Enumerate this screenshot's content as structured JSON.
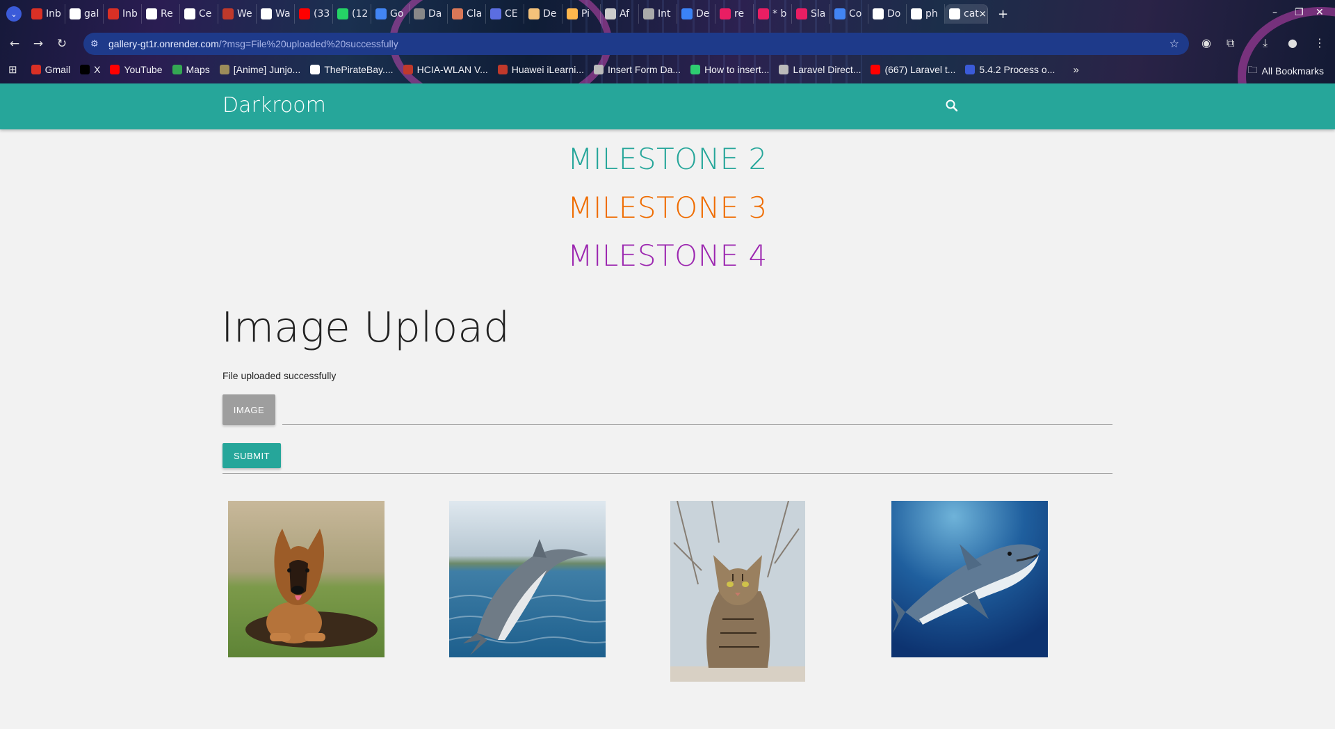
{
  "browser": {
    "tabs": [
      {
        "title": "Inb",
        "color": "#d93025"
      },
      {
        "title": "gal",
        "color": "#ffffff"
      },
      {
        "title": "Inb",
        "color": "#d93025"
      },
      {
        "title": "Re",
        "color": "#ffffff"
      },
      {
        "title": "Ce",
        "color": "#ffffff"
      },
      {
        "title": "We",
        "color": "#c0392b"
      },
      {
        "title": "Wa",
        "color": "#ffffff"
      },
      {
        "title": "(33",
        "color": "#ff0000"
      },
      {
        "title": "(12",
        "color": "#25d366"
      },
      {
        "title": "Go",
        "color": "#4285f4"
      },
      {
        "title": "Da",
        "color": "#888888"
      },
      {
        "title": "Cla",
        "color": "#d97757"
      },
      {
        "title": "CE",
        "color": "#5b6ee1"
      },
      {
        "title": "De",
        "color": "#f4c27a"
      },
      {
        "title": "Pi",
        "color": "#ffb74d"
      },
      {
        "title": "Af",
        "color": "#cccccc"
      },
      {
        "title": "Int",
        "color": "#aaaaaa"
      },
      {
        "title": "De",
        "color": "#3b82f6"
      },
      {
        "title": "re",
        "color": "#e91e63"
      },
      {
        "title": "* b",
        "color": "#e91e63"
      },
      {
        "title": "Sla",
        "color": "#e91e63"
      },
      {
        "title": "Co",
        "color": "#4285f4"
      },
      {
        "title": "Do",
        "color": "#ffffff"
      },
      {
        "title": "ph",
        "color": "#ffffff"
      },
      {
        "title": "cat",
        "color": "#ffffff"
      }
    ],
    "active_tab_close": "×",
    "new_tab": "+",
    "url_host": "gallery-gt1r.onrender.com",
    "url_path": "/?msg=File%20uploaded%20successfully",
    "bookmarks": [
      {
        "label": "Gmail",
        "color": "#d93025"
      },
      {
        "label": "X",
        "color": "#000000"
      },
      {
        "label": "YouTube",
        "color": "#ff0000"
      },
      {
        "label": "Maps",
        "color": "#34a853"
      },
      {
        "label": "[Anime] Junjo...",
        "color": "#9c8c5a"
      },
      {
        "label": "ThePirateBay....",
        "color": "#ffffff"
      },
      {
        "label": "HCIA-WLAN V...",
        "color": "#c0392b"
      },
      {
        "label": "Huawei iLearni...",
        "color": "#c0392b"
      },
      {
        "label": "Insert Form Da...",
        "color": "#bbbbbb"
      },
      {
        "label": "How to insert...",
        "color": "#2ecc71"
      },
      {
        "label": "Laravel Direct...",
        "color": "#bbbbbb"
      },
      {
        "label": "(667) Laravel t...",
        "color": "#ff0000"
      },
      {
        "label": "5.4.2 Process o...",
        "color": "#3b5bd9"
      }
    ],
    "all_bookmarks": "All Bookmarks"
  },
  "nav": {
    "brand": "Darkroom",
    "search_icon": "search-icon"
  },
  "milestones": [
    "MILESTONE 2",
    "MILESTONE 3",
    "MILESTONE 4"
  ],
  "colors": {
    "teal": "#26a69a",
    "orange": "#ef6c00",
    "purple": "#9c27b0"
  },
  "upload": {
    "title": "Image Upload",
    "message": "File uploaded successfully",
    "image_button": "IMAGE",
    "submit_button": "SUBMIT"
  },
  "gallery": [
    {
      "subject": "german shepherd dog"
    },
    {
      "subject": "dolphin"
    },
    {
      "subject": "tabby cat"
    },
    {
      "subject": "great white shark"
    }
  ]
}
